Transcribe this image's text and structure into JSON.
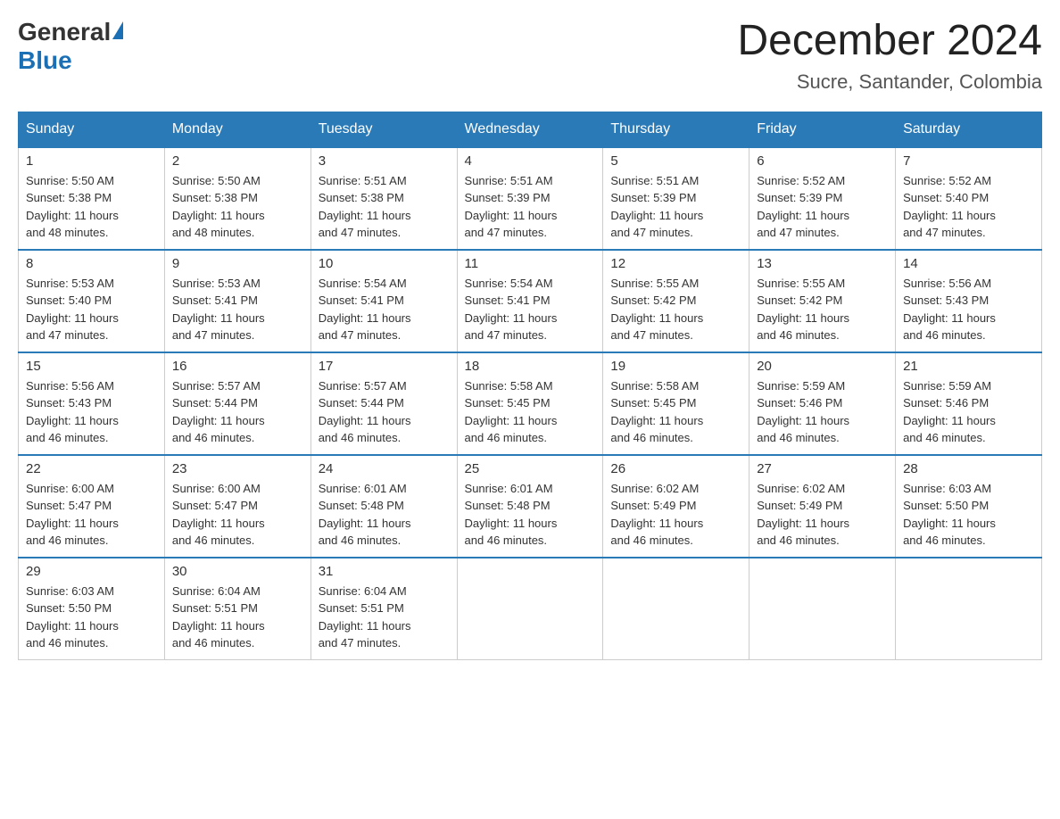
{
  "header": {
    "logo_general": "General",
    "logo_blue": "Blue",
    "month_year": "December 2024",
    "location": "Sucre, Santander, Colombia"
  },
  "columns": [
    "Sunday",
    "Monday",
    "Tuesday",
    "Wednesday",
    "Thursday",
    "Friday",
    "Saturday"
  ],
  "weeks": [
    [
      {
        "day": "1",
        "sunrise": "5:50 AM",
        "sunset": "5:38 PM",
        "daylight": "11 hours and 48 minutes."
      },
      {
        "day": "2",
        "sunrise": "5:50 AM",
        "sunset": "5:38 PM",
        "daylight": "11 hours and 48 minutes."
      },
      {
        "day": "3",
        "sunrise": "5:51 AM",
        "sunset": "5:38 PM",
        "daylight": "11 hours and 47 minutes."
      },
      {
        "day": "4",
        "sunrise": "5:51 AM",
        "sunset": "5:39 PM",
        "daylight": "11 hours and 47 minutes."
      },
      {
        "day": "5",
        "sunrise": "5:51 AM",
        "sunset": "5:39 PM",
        "daylight": "11 hours and 47 minutes."
      },
      {
        "day": "6",
        "sunrise": "5:52 AM",
        "sunset": "5:39 PM",
        "daylight": "11 hours and 47 minutes."
      },
      {
        "day": "7",
        "sunrise": "5:52 AM",
        "sunset": "5:40 PM",
        "daylight": "11 hours and 47 minutes."
      }
    ],
    [
      {
        "day": "8",
        "sunrise": "5:53 AM",
        "sunset": "5:40 PM",
        "daylight": "11 hours and 47 minutes."
      },
      {
        "day": "9",
        "sunrise": "5:53 AM",
        "sunset": "5:41 PM",
        "daylight": "11 hours and 47 minutes."
      },
      {
        "day": "10",
        "sunrise": "5:54 AM",
        "sunset": "5:41 PM",
        "daylight": "11 hours and 47 minutes."
      },
      {
        "day": "11",
        "sunrise": "5:54 AM",
        "sunset": "5:41 PM",
        "daylight": "11 hours and 47 minutes."
      },
      {
        "day": "12",
        "sunrise": "5:55 AM",
        "sunset": "5:42 PM",
        "daylight": "11 hours and 47 minutes."
      },
      {
        "day": "13",
        "sunrise": "5:55 AM",
        "sunset": "5:42 PM",
        "daylight": "11 hours and 46 minutes."
      },
      {
        "day": "14",
        "sunrise": "5:56 AM",
        "sunset": "5:43 PM",
        "daylight": "11 hours and 46 minutes."
      }
    ],
    [
      {
        "day": "15",
        "sunrise": "5:56 AM",
        "sunset": "5:43 PM",
        "daylight": "11 hours and 46 minutes."
      },
      {
        "day": "16",
        "sunrise": "5:57 AM",
        "sunset": "5:44 PM",
        "daylight": "11 hours and 46 minutes."
      },
      {
        "day": "17",
        "sunrise": "5:57 AM",
        "sunset": "5:44 PM",
        "daylight": "11 hours and 46 minutes."
      },
      {
        "day": "18",
        "sunrise": "5:58 AM",
        "sunset": "5:45 PM",
        "daylight": "11 hours and 46 minutes."
      },
      {
        "day": "19",
        "sunrise": "5:58 AM",
        "sunset": "5:45 PM",
        "daylight": "11 hours and 46 minutes."
      },
      {
        "day": "20",
        "sunrise": "5:59 AM",
        "sunset": "5:46 PM",
        "daylight": "11 hours and 46 minutes."
      },
      {
        "day": "21",
        "sunrise": "5:59 AM",
        "sunset": "5:46 PM",
        "daylight": "11 hours and 46 minutes."
      }
    ],
    [
      {
        "day": "22",
        "sunrise": "6:00 AM",
        "sunset": "5:47 PM",
        "daylight": "11 hours and 46 minutes."
      },
      {
        "day": "23",
        "sunrise": "6:00 AM",
        "sunset": "5:47 PM",
        "daylight": "11 hours and 46 minutes."
      },
      {
        "day": "24",
        "sunrise": "6:01 AM",
        "sunset": "5:48 PM",
        "daylight": "11 hours and 46 minutes."
      },
      {
        "day": "25",
        "sunrise": "6:01 AM",
        "sunset": "5:48 PM",
        "daylight": "11 hours and 46 minutes."
      },
      {
        "day": "26",
        "sunrise": "6:02 AM",
        "sunset": "5:49 PM",
        "daylight": "11 hours and 46 minutes."
      },
      {
        "day": "27",
        "sunrise": "6:02 AM",
        "sunset": "5:49 PM",
        "daylight": "11 hours and 46 minutes."
      },
      {
        "day": "28",
        "sunrise": "6:03 AM",
        "sunset": "5:50 PM",
        "daylight": "11 hours and 46 minutes."
      }
    ],
    [
      {
        "day": "29",
        "sunrise": "6:03 AM",
        "sunset": "5:50 PM",
        "daylight": "11 hours and 46 minutes."
      },
      {
        "day": "30",
        "sunrise": "6:04 AM",
        "sunset": "5:51 PM",
        "daylight": "11 hours and 46 minutes."
      },
      {
        "day": "31",
        "sunrise": "6:04 AM",
        "sunset": "5:51 PM",
        "daylight": "11 hours and 47 minutes."
      },
      null,
      null,
      null,
      null
    ]
  ],
  "labels": {
    "sunrise": "Sunrise:",
    "sunset": "Sunset:",
    "daylight": "Daylight:"
  }
}
